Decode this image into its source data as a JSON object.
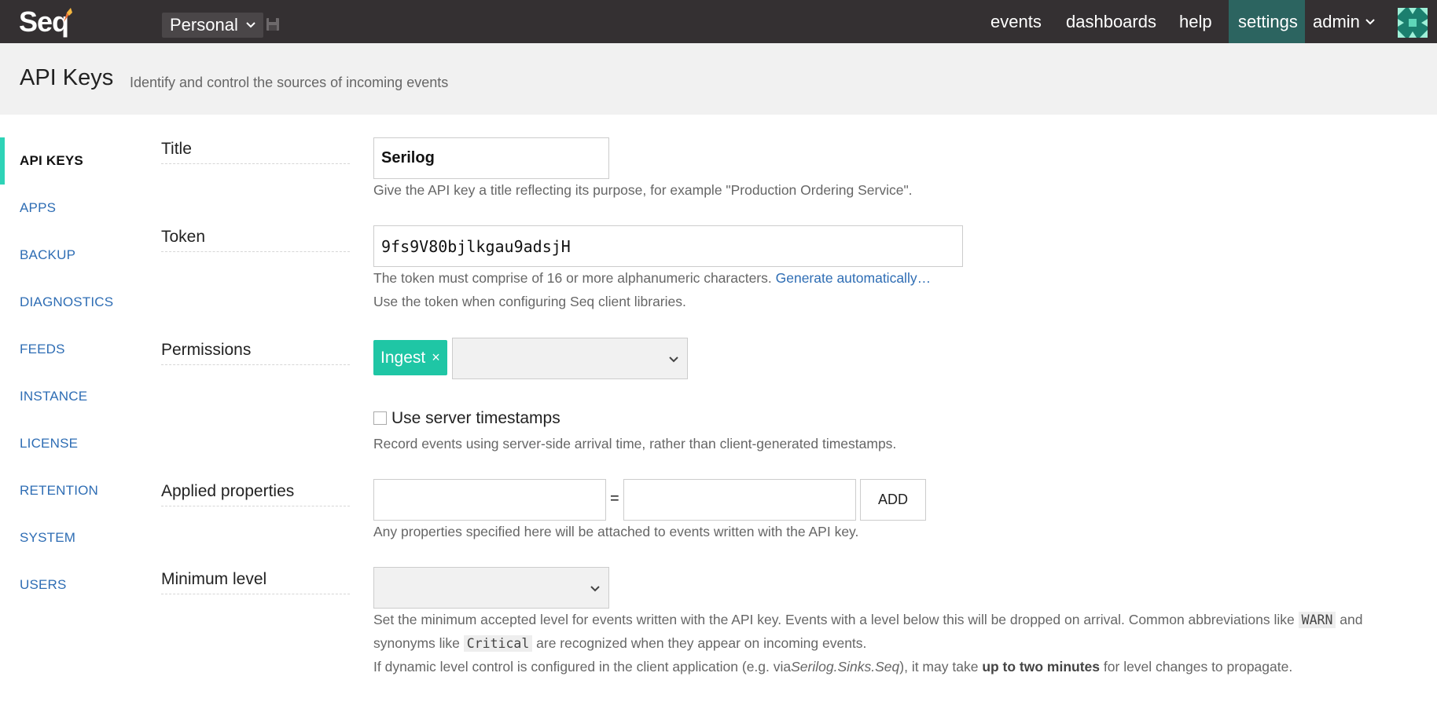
{
  "topbar": {
    "logo": "Seq",
    "workspace": "Personal",
    "nav": {
      "events": "events",
      "dashboards": "dashboards",
      "help": "help",
      "settings": "settings"
    },
    "user": "admin",
    "accent_color": "#2c6460",
    "icons": [
      "chevron-down-icon",
      "save-icon",
      "avatar-icon"
    ]
  },
  "header": {
    "title": "API Keys",
    "subtitle": "Identify and control the sources of incoming events"
  },
  "sidebar": {
    "items": [
      {
        "label": "API KEYS",
        "active": true
      },
      {
        "label": "APPS"
      },
      {
        "label": "BACKUP"
      },
      {
        "label": "DIAGNOSTICS"
      },
      {
        "label": "FEEDS"
      },
      {
        "label": "INSTANCE"
      },
      {
        "label": "LICENSE"
      },
      {
        "label": "RETENTION"
      },
      {
        "label": "SYSTEM"
      },
      {
        "label": "USERS"
      }
    ],
    "active_color": "#2ed3b7"
  },
  "form": {
    "title": {
      "label": "Title",
      "value": "Serilog",
      "help": "Give the API key a title reflecting its purpose, for example \"Production Ordering Service\"."
    },
    "token": {
      "label": "Token",
      "value": "9fs9V80bjlkgau9adsjH",
      "help1": "The token must comprise of 16 or more alphanumeric characters.",
      "generate_link": "Generate automatically…",
      "help2": "Use the token when configuring Seq client libraries."
    },
    "permissions": {
      "label": "Permissions",
      "tag": "Ingest",
      "tag_remove": "×",
      "tag_color": "#1fc6a5",
      "select_value": ""
    },
    "timestamps": {
      "checkbox_label": "Use server timestamps",
      "checked": false,
      "help": "Record events using server-side arrival time, rather than client-generated timestamps."
    },
    "applied_properties": {
      "label": "Applied properties",
      "name_value": "",
      "equals": "=",
      "value_value": "",
      "add_button": "ADD",
      "help": "Any properties specified here will be attached to events written with the API key."
    },
    "minimum_level": {
      "label": "Minimum level",
      "select_value": "",
      "help1_a": "Set the minimum accepted level for events written with the API key. Events with a level below this will be dropped on arrival. Common abbreviations like",
      "help1_code1": "WARN",
      "help1_b": "and",
      "help2_a": "synonyms like",
      "help2_code": "Critical",
      "help2_b": "are recognized when they appear on incoming events.",
      "help3_a": "If dynamic level control is configured in the client application (e.g. via",
      "help3_em": "Serilog.Sinks.Seq",
      "help3_b": "), it may take",
      "help3_strong": "up to two minutes",
      "help3_c": "for level changes to propagate."
    }
  }
}
